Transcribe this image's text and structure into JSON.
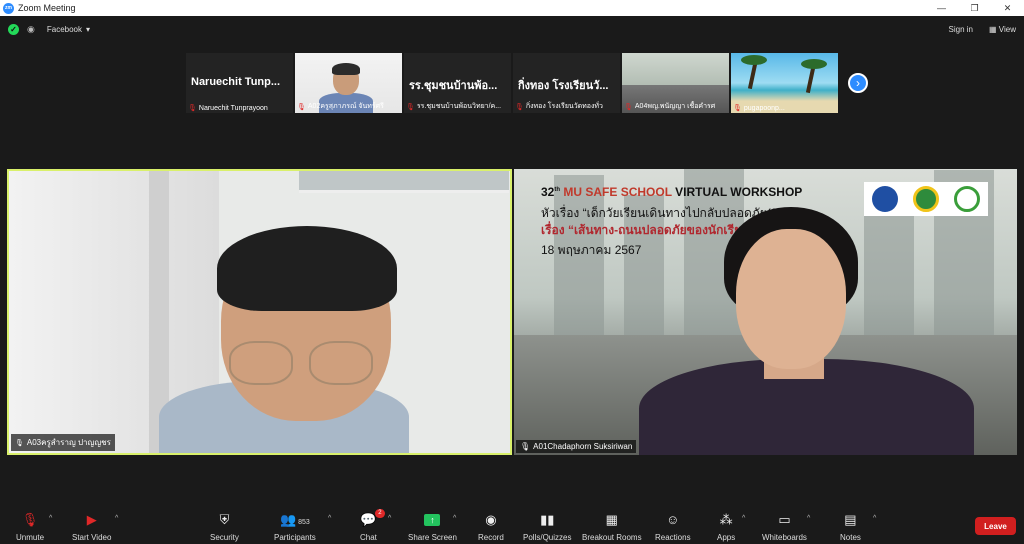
{
  "window": {
    "title": "Zoom Meeting"
  },
  "topbar": {
    "livestream_label": "Facebook",
    "sign_in": "Sign in",
    "view": "View"
  },
  "thumbnails": [
    {
      "big_name": "Naruechit Tunp...",
      "caption": "Naruechit Tunprayoon"
    },
    {
      "caption": "A02ครูสุภาภรณ์ จันทร์ศรี"
    },
    {
      "big_name": "รร.ชุมชนบ้านพ้อ...",
      "caption": "รร.ชุมชนบ้านพ้อนวิทยา/ค..."
    },
    {
      "big_name": "กิ่งทอง โรงเรียนวั...",
      "caption": "กิ่งทอง โรงเรียนวัดทองทั่ว"
    },
    {
      "caption": "A04พญ.พนัญญา เชื้อคำรศ"
    },
    {
      "caption": "pugapoonp..."
    }
  ],
  "main_left": {
    "caption": "A03ครูสำราญ ปาญญชร"
  },
  "main_right": {
    "caption": "A01Chadaphorn Suksiriwan",
    "slide": {
      "title_prefix": "32",
      "title_accent": "MU SAFE SCHOOL",
      "title_suffix": "VIRTUAL WORKSHOP",
      "line1": "หัวเรื่อง “เด็กวัยเรียนเดินทางไปกลับปลอดภัย(2)”",
      "line2": "เรื่อง “เส้นทาง-ถนนปลอดภัยของนักเรีย...",
      "date": "18 พฤษภาคม 2567"
    }
  },
  "toolbar": {
    "unmute": "Unmute",
    "start_video": "Start Video",
    "security": "Security",
    "participants": "Participants",
    "participants_count": "853",
    "chat": "Chat",
    "chat_badge": "2",
    "share": "Share Screen",
    "record": "Record",
    "polls": "Polls/Quizzes",
    "breakout": "Breakout Rooms",
    "reactions": "Reactions",
    "apps": "Apps",
    "whiteboards": "Whiteboards",
    "notes": "Notes",
    "leave": "Leave"
  }
}
